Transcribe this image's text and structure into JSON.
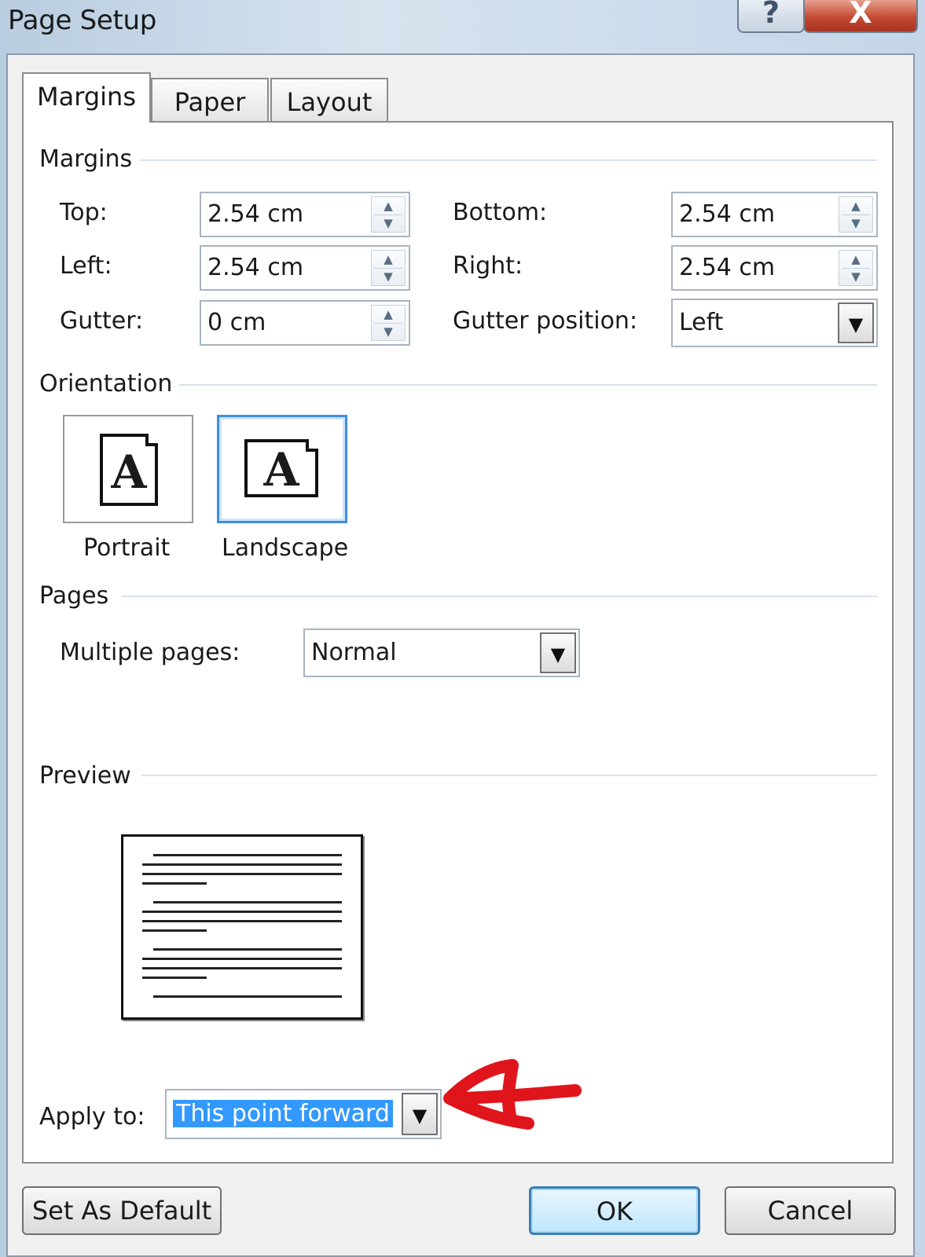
{
  "window": {
    "title": "Page Setup",
    "help_glyph": "?",
    "close_glyph": "X"
  },
  "tabs": [
    {
      "label": "Margins",
      "active": true
    },
    {
      "label": "Paper",
      "active": false
    },
    {
      "label": "Layout",
      "active": false
    }
  ],
  "margins_section": {
    "heading": "Margins",
    "top": {
      "label": "Top:",
      "value": "2.54 cm"
    },
    "bottom": {
      "label": "Bottom:",
      "value": "2.54 cm"
    },
    "left": {
      "label": "Left:",
      "value": "2.54 cm"
    },
    "right": {
      "label": "Right:",
      "value": "2.54 cm"
    },
    "gutter": {
      "label": "Gutter:",
      "value": "0 cm"
    },
    "gutter_position": {
      "label": "Gutter position:",
      "value": "Left"
    }
  },
  "orientation": {
    "heading": "Orientation",
    "portrait_label": "Portrait",
    "landscape_label": "Landscape",
    "icon_letter": "A",
    "selected": "Landscape"
  },
  "pages": {
    "heading": "Pages",
    "multiple_pages_label": "Multiple pages:",
    "multiple_pages_value": "Normal"
  },
  "preview": {
    "heading": "Preview"
  },
  "apply_to": {
    "label": "Apply to:",
    "value": "This point forward"
  },
  "buttons": {
    "set_default": "Set As Default",
    "ok": "OK",
    "cancel": "Cancel"
  },
  "colors": {
    "selection": "#3399ff",
    "annotation_arrow": "#e0151c",
    "focus_border": "#3d8ee0"
  },
  "icons": {
    "spin_up": "▲",
    "spin_down": "▼",
    "dropdown": "▼"
  }
}
